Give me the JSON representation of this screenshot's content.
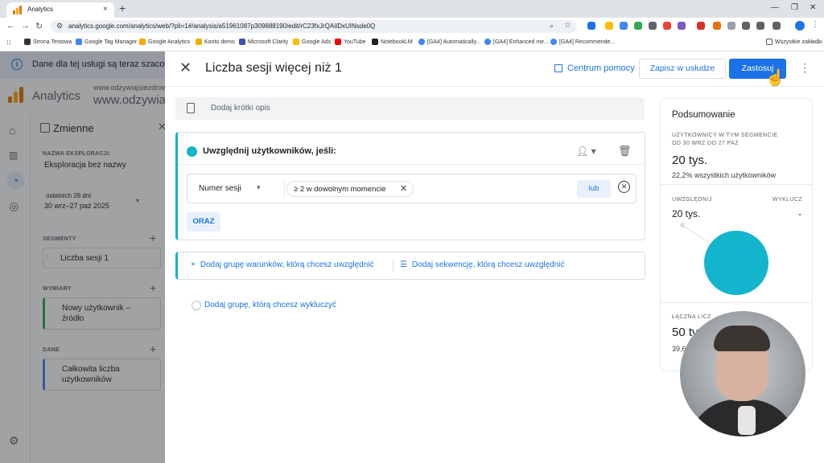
{
  "browser": {
    "tab_title": "Analytics",
    "new_tab_label": "+",
    "url": "analytics.google.com/analytics/web/?pli=1#/analysis/a51961087p309888190/edit/rC23fxJrQAiIDxUINsde0Q",
    "bookmarks": [
      "Strona Testowa",
      "Google Tag Manager",
      "Google Analytics",
      "Konto demo",
      "Microsoft Clarity",
      "Google Ads",
      "YouTube",
      "NotebookLM",
      "[GA4] Automatically...",
      "[GA4] Enhanced me...",
      "[GA4] Recommende..."
    ],
    "all_bookmarks": "Wszystkie zakładki"
  },
  "ga": {
    "notice": "Dane dla tej usługi są teraz szacowan",
    "title": "Analytics",
    "domain_small": "www.odzywiajsiezdrowo.",
    "domain_big": "www.odzywia",
    "variables": {
      "title": "Zmienne",
      "exploration_label": "NAZWA EKSPLORACJI:",
      "exploration_name": "Eksploracja bez nazwy",
      "date_range_label": "ostatnich 28 dni",
      "date_range": "30 wrz–27 paź 2025",
      "segments_label": "SEGMENTY",
      "segment_item": "Liczba sesji 1",
      "dimensions_label": "WYMIARY",
      "dimension_item": "Nowy użytkownik – źródło",
      "metrics_label": "DANE",
      "metric_item": "Całkowita liczba użytkowników"
    }
  },
  "panel": {
    "title": "Liczba sesji więcej niż 1",
    "help": "Centrum pomocy",
    "save": "Zapisz w usłudze",
    "apply": "Zastosuj",
    "description_placeholder": "Dodaj krótki opis",
    "condition": {
      "title": "Uwzględnij użytkowników, jeśli:",
      "dimension": "Numer sesji",
      "chip": "≥ 2 w dowolnym momencie",
      "or": "lub",
      "and": "ORAZ"
    },
    "add_include_group": "Dodaj grupę warunków, którą chcesz uwzględnić",
    "add_sequence": "Dodaj sekwencję, którą chcesz uwzględnić",
    "add_exclude_group": "Dodaj grupę, którą chcesz wykluczyć"
  },
  "summary": {
    "title": "Podsumowanie",
    "users_label_1": "UŻYTKOWNICY W TYM SEGMENCIE",
    "users_label_2": "OD 30 WRZ DO 27 PAŹ",
    "users_value": "20 tys.",
    "users_pct": "22,2% wszystkich użytkowników",
    "include_label": "UWZGLĘDNIJ",
    "exclude_label": "WYKLUCZ",
    "include_value": "20 tys.",
    "exclude_value": "-",
    "total_label": "ŁĄCZNA LICZ",
    "total_value": "50 ty",
    "total_sub": "39,6"
  },
  "colors": {
    "accent": "#1a73e8",
    "segment": "#12b5cb",
    "dimension_bar": "#34a853",
    "metric_bar": "#4285f4"
  }
}
